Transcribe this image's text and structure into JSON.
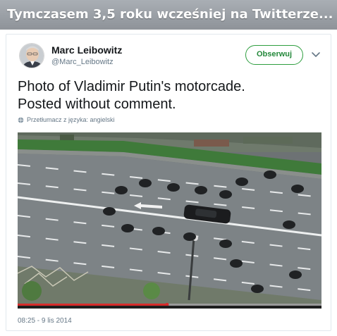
{
  "banner": {
    "title": "Tymczasem 3,5 roku wcześniej na Twitterze..."
  },
  "tweet": {
    "author_name": "Marc Leibowitz",
    "author_handle": "@Marc_Leibowitz",
    "follow_label": "Obserwuj",
    "text_line1": "Photo of Vladimir Putin's motorcade.",
    "text_line2": "Posted without comment.",
    "translate_label": "Przetłumacz z języka: angielski",
    "timestamp": "08:25 - 9 lis 2014"
  },
  "colors": {
    "follow_green": "#2e9e3f",
    "banner_gray": "#9a9fa5",
    "video_progress_red": "#d62b2b"
  },
  "icons": [
    "avatar",
    "chevron-down-icon",
    "globe-icon"
  ]
}
